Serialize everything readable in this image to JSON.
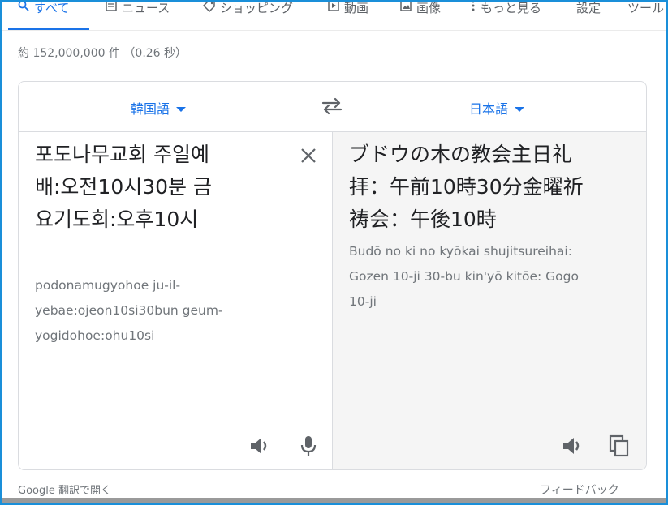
{
  "tabs": [
    {
      "label": "すべて",
      "icon": "search-icon",
      "active": true
    },
    {
      "label": "ニュース",
      "icon": "news-icon"
    },
    {
      "label": "ショッピング",
      "icon": "tag-icon"
    },
    {
      "label": "動画",
      "icon": "video-icon"
    },
    {
      "label": "画像",
      "icon": "image-icon"
    },
    {
      "label": "もっと見る",
      "icon": "more-vert-icon"
    },
    {
      "label": "設定"
    },
    {
      "label": "ツール"
    }
  ],
  "result_stats": "約 152,000,000 件 （0.26 秒）",
  "translator": {
    "source_lang": "韓国語",
    "target_lang": "日本語",
    "source_text": "포도나무교회 주일예\n배:오전10시30분 금\n요기도회:오후10시",
    "source_romanization": "podonamugyohoe ju-il-\nyebae:ojeon10si30bun geum-\nyogidohoe:ohu10si",
    "target_text": "ブドウの木の教会主日礼\n拝：午前10時30分金曜祈\n祷会：午後10時",
    "target_romanization": "Budō no ki no kyōkai shujitsureihai:\nGozen 10-ji 30-bu kin'yō kitōe: Gogo\n10-ji"
  },
  "footer": {
    "open_in_translate": "Google 翻訳で開く",
    "feedback": "フィードバック"
  },
  "colors": {
    "accent": "#1a73e8",
    "frame": "#1a8fd9",
    "muted_text": "#70757a"
  }
}
